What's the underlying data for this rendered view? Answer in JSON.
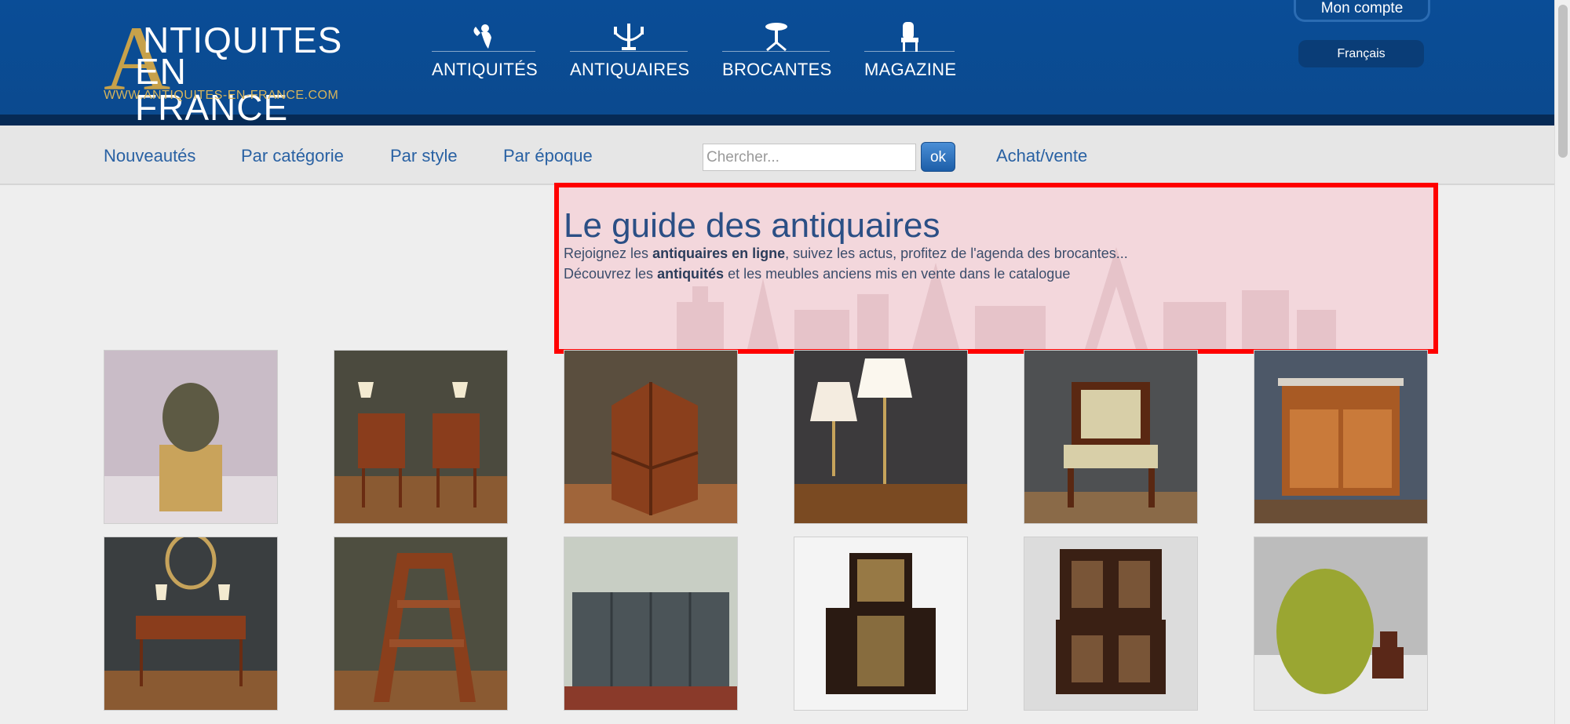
{
  "logo": {
    "letter": "A",
    "line1": "NTIQUITES",
    "line2": "EN FRANCE",
    "url": "WWW.ANTIQUITES-EN-FRANCE.COM"
  },
  "topnav": [
    {
      "label": "ANTIQUITÉS",
      "icon": "cherub-icon"
    },
    {
      "label": "ANTIQUAIRES",
      "icon": "candelabra-icon"
    },
    {
      "label": "BROCANTES",
      "icon": "gueridon-table-icon"
    },
    {
      "label": "MAGAZINE",
      "icon": "chair-icon"
    }
  ],
  "account": {
    "label": "Mon compte"
  },
  "language": {
    "label": "Français"
  },
  "subnav": {
    "items": [
      "Nouveautés",
      "Par catégorie",
      "Par style",
      "Par époque"
    ],
    "search_placeholder": "Chercher...",
    "ok_label": "ok",
    "buy_sell": "Achat/vente"
  },
  "guide": {
    "title": "Le guide des antiquaires",
    "line1_pre": "Rejoignez les ",
    "line1_bold": "antiquaires en ligne",
    "line1_post": ", suivez les actus, profitez de l'agenda des brocantes...",
    "line2_pre": "Découvrez les ",
    "line2_bold": "antiquités",
    "line2_post": " et les meubles anciens mis en vente dans le catalogue"
  },
  "products": [
    {
      "name": "bronze-head-sculpture"
    },
    {
      "name": "pair-of-bedside-tables"
    },
    {
      "name": "revolving-bookcase"
    },
    {
      "name": "pair-of-lamps"
    },
    {
      "name": "empire-armchair"
    },
    {
      "name": "marquetry-commode"
    },
    {
      "name": "writing-desk"
    },
    {
      "name": "library-step-chair"
    },
    {
      "name": "folding-screen"
    },
    {
      "name": "boulle-cabinet"
    },
    {
      "name": "inlaid-buffet"
    },
    {
      "name": "pear-and-dog-figurine"
    }
  ]
}
